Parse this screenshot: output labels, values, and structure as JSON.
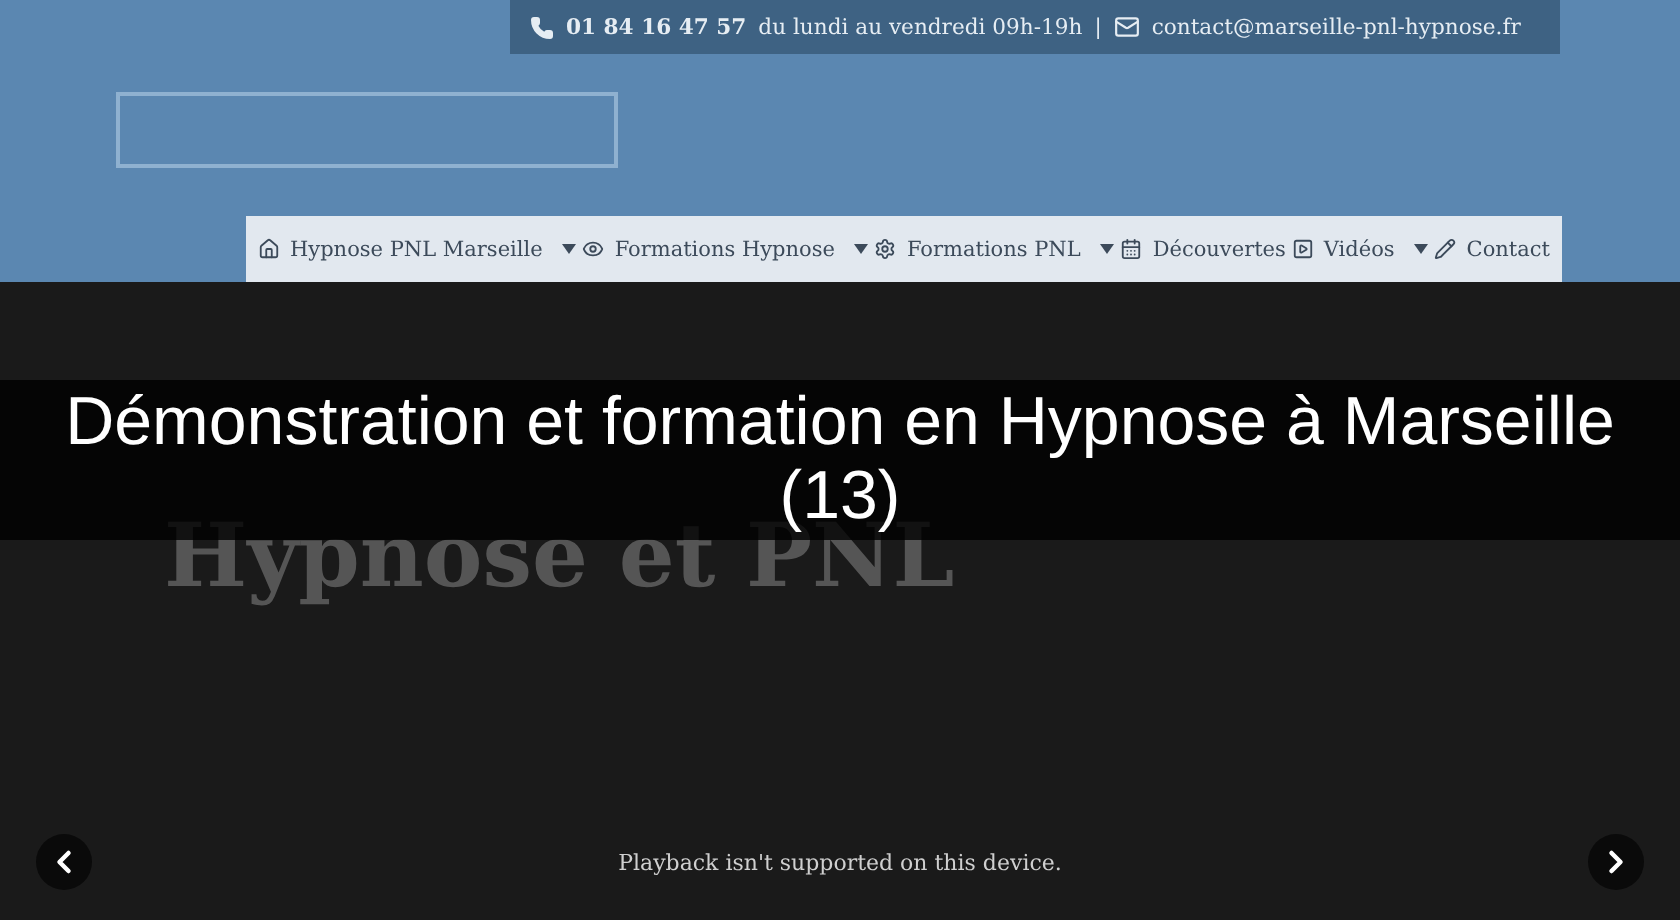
{
  "topbar": {
    "phone": "01 84 16 47 57",
    "hours": "du lundi au vendredi 09h-19h",
    "separator": "|",
    "email": "contact@marseille-pnl-hypnose.fr"
  },
  "nav": [
    {
      "kind": "home",
      "label": "Hypnose PNL Marseille",
      "dropdown": true
    },
    {
      "kind": "eye",
      "label": "Formations Hypnose",
      "dropdown": true
    },
    {
      "kind": "gear",
      "label": "Formations PNL",
      "dropdown": true
    },
    {
      "kind": "calendar",
      "label": "Découvertes",
      "dropdown": false
    },
    {
      "kind": "play",
      "label": "Vidéos",
      "dropdown": true
    },
    {
      "kind": "pencil",
      "label": "Contact",
      "dropdown": false
    }
  ],
  "slide": {
    "subheadline": "Hypnose et PNL",
    "message": "Playback isn't supported on this device."
  },
  "title": "Démonstration et formation en Hypnose à Marseille (13)"
}
